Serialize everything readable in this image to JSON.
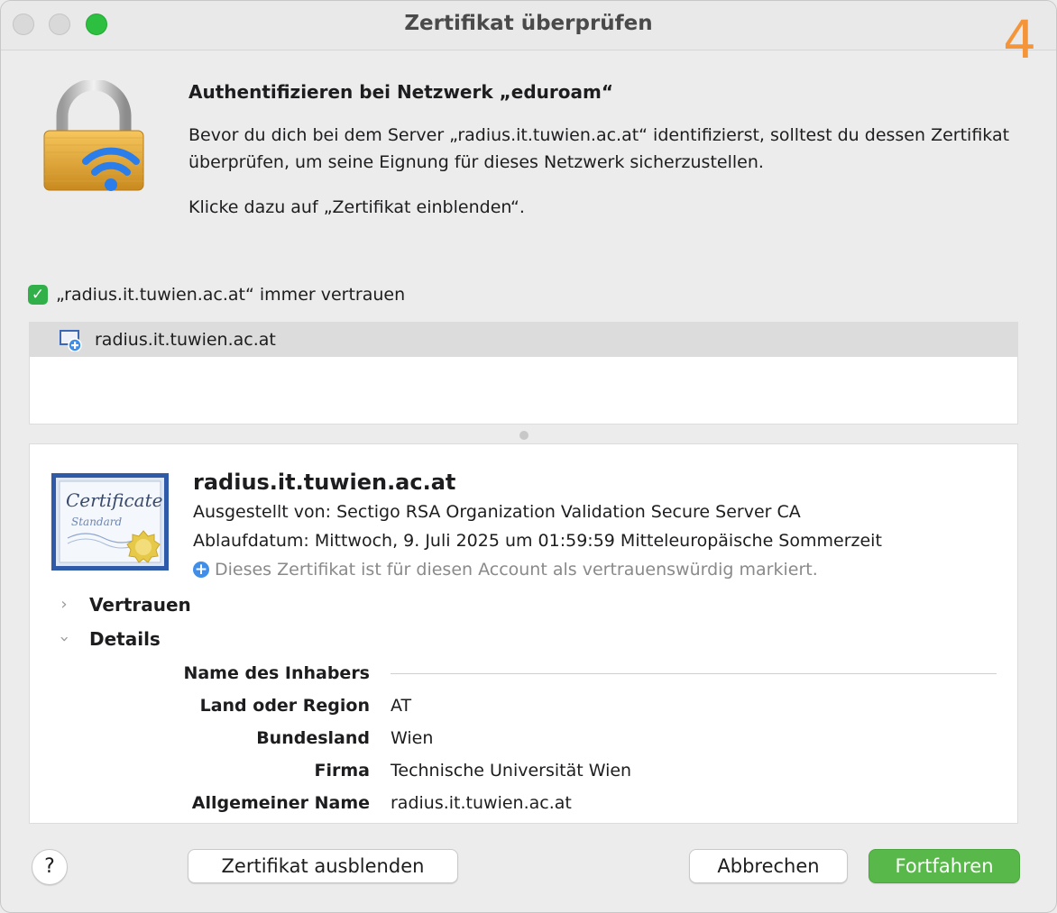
{
  "window": {
    "title": "Zertifikat überprüfen",
    "step_badge": "4"
  },
  "header": {
    "heading": "Authentifizieren bei Netzwerk „eduroam“",
    "intro": "Bevor du dich bei dem Server „radius.it.tuwien.ac.at“ identifizierst, solltest du dessen Zertifikat überprüfen, um seine Eignung für dieses Netzwerk sicherzustellen.",
    "hint": "Klicke dazu auf „Zertifikat einblenden“."
  },
  "trust_checkbox": {
    "checked": true,
    "label": "„radius.it.tuwien.ac.at“ immer vertrauen"
  },
  "certificate_list": {
    "items": [
      {
        "label": "radius.it.tuwien.ac.at",
        "selected": true
      }
    ]
  },
  "certificate_detail": {
    "badge_text_1": "Certificate",
    "badge_text_2": "Standard",
    "title": "radius.it.tuwien.ac.at",
    "issued_by": "Ausgestellt von: Sectigo RSA Organization Validation Secure Server CA",
    "expiry": "Ablaufdatum: Mittwoch, 9. Juli 2025 um 01:59:59 Mitteleuropäische Sommerzeit",
    "trust_note": "Dieses Zertifikat ist für diesen Account als vertrauenswürdig markiert.",
    "sections": [
      {
        "label": "Vertrauen",
        "expanded": false
      },
      {
        "label": "Details",
        "expanded": true
      }
    ],
    "fields": [
      {
        "key": "Name des Inhabers",
        "value": ""
      },
      {
        "key": "Land oder Region",
        "value": "AT"
      },
      {
        "key": "Bundesland",
        "value": "Wien"
      },
      {
        "key": "Firma",
        "value": "Technische Universität Wien"
      },
      {
        "key": "Allgemeiner Name",
        "value": "radius.it.tuwien.ac.at"
      }
    ]
  },
  "buttons": {
    "help": "?",
    "toggle_certificate": "Zertifikat ausblenden",
    "cancel": "Abbrechen",
    "continue": "Fortfahren"
  },
  "colors": {
    "accent_green": "#58b84a",
    "badge_orange": "#f5953a",
    "wifi_blue": "#2b7de9",
    "trust_blue": "#3f8ee9"
  }
}
